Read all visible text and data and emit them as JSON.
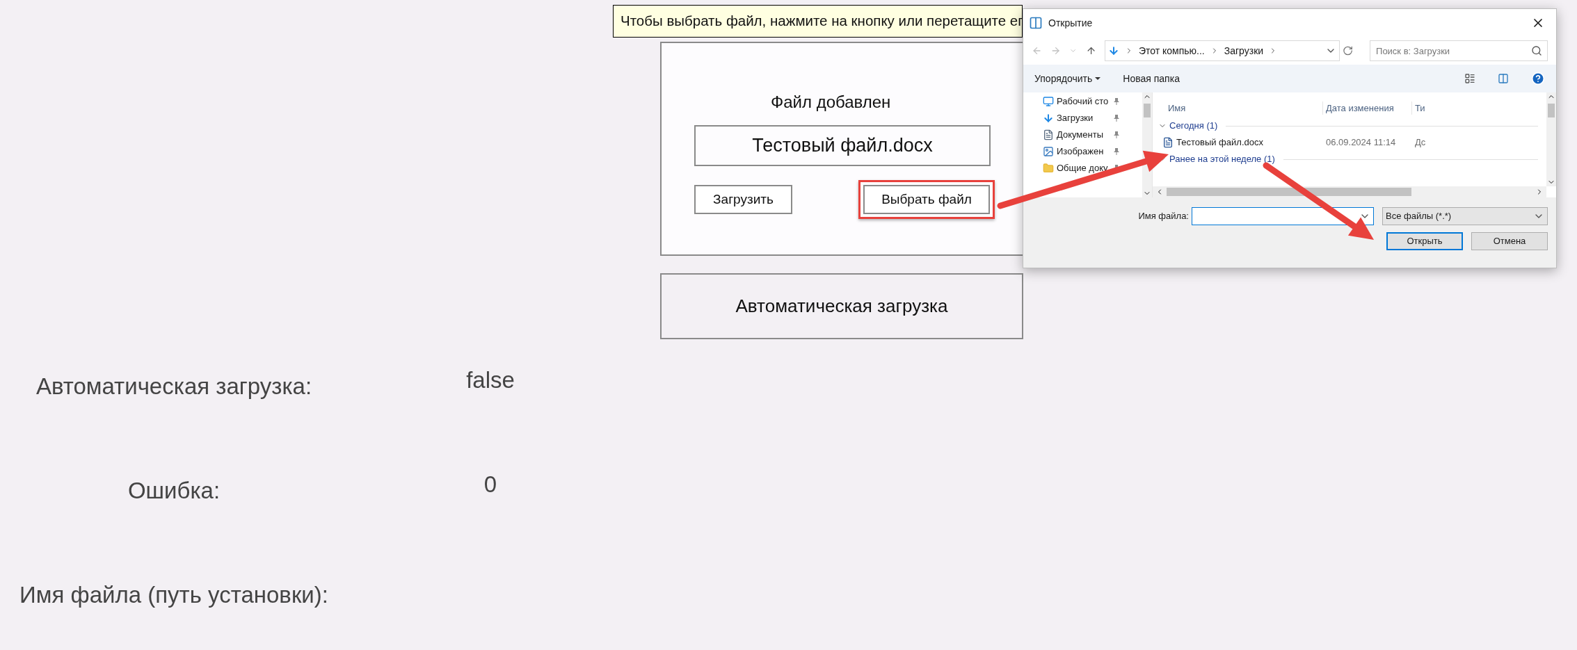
{
  "tooltip": {
    "text": "Чтобы выбрать файл, нажмите на кнопку или перетащите ег"
  },
  "upload_panel": {
    "status": "Файл добавлен",
    "file_name": "Тестовый файл.docx",
    "buttons": [
      {
        "label": "Загрузить",
        "highlighted": false
      },
      {
        "label": "Выбрать файл",
        "highlighted": true
      }
    ]
  },
  "auto_button": {
    "label": "Автоматическая загрузка"
  },
  "fields": [
    {
      "label": "Автоматическая загрузка:",
      "value": "false"
    },
    {
      "label": "Ошибка:",
      "value": "0"
    },
    {
      "label": "Имя файла (путь установки):"
    }
  ],
  "dialog": {
    "title": "Открытие",
    "breadcrumb": [
      "Этот компью...",
      "Загрузки"
    ],
    "search": {
      "placeholder": "Поиск в: Загрузки"
    },
    "toolbar": [
      {
        "label": "Упорядочить",
        "dropdown": true
      },
      {
        "label": "Новая папка",
        "dropdown": false
      }
    ],
    "nav_items": [
      {
        "label": "Рабочий сто",
        "kind": "desktop",
        "pinned": true
      },
      {
        "label": "Загрузки",
        "kind": "downloads",
        "pinned": true
      },
      {
        "label": "Документы",
        "kind": "documents",
        "pinned": true
      },
      {
        "label": "Изображен",
        "kind": "pictures",
        "pinned": true
      },
      {
        "label": "Общие доку",
        "kind": "folder",
        "pinned": true
      }
    ],
    "columns": [
      "Имя",
      "Дата изменения",
      "Ти"
    ],
    "groups": [
      {
        "label": "Сегодня (1)",
        "expanded": true,
        "files": [
          {
            "name": "Тестовый файл.docx",
            "date": "06.09.2024 11:14",
            "type": "Дс"
          }
        ]
      },
      {
        "label": "Ранее на этой неделе (1)",
        "expanded": false
      }
    ],
    "file_name_label": "Имя файла:",
    "filter": "Все файлы (*.*)",
    "buttons": [
      {
        "label": "Открыть",
        "default": true
      },
      {
        "label": "Отмена",
        "default": false
      }
    ]
  }
}
